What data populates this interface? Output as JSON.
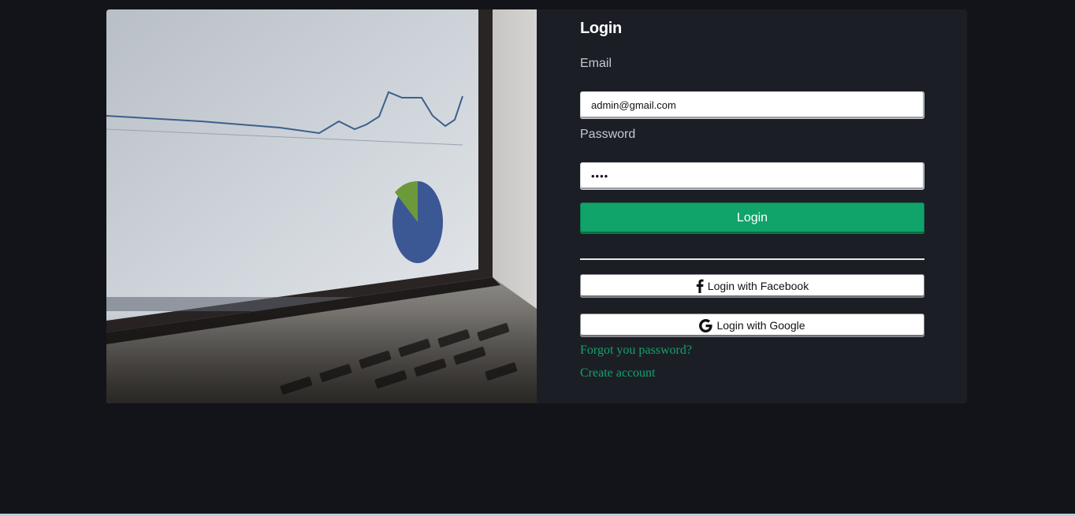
{
  "login": {
    "title": "Login",
    "email_label": "Email",
    "email_value": "admin@gmail.com",
    "password_label": "Password",
    "password_value": "••••",
    "submit_label": "Login",
    "facebook_label": "Login with Facebook",
    "google_label": "Login with Google",
    "forgot_label": "Forgot you password?",
    "create_label": "Create account"
  },
  "icons": {
    "facebook": "facebook-icon",
    "google": "google-icon"
  },
  "colors": {
    "page_bg": "#131419",
    "card_bg": "#1c1e26",
    "accent": "#10a36a",
    "link": "#10a36a"
  }
}
